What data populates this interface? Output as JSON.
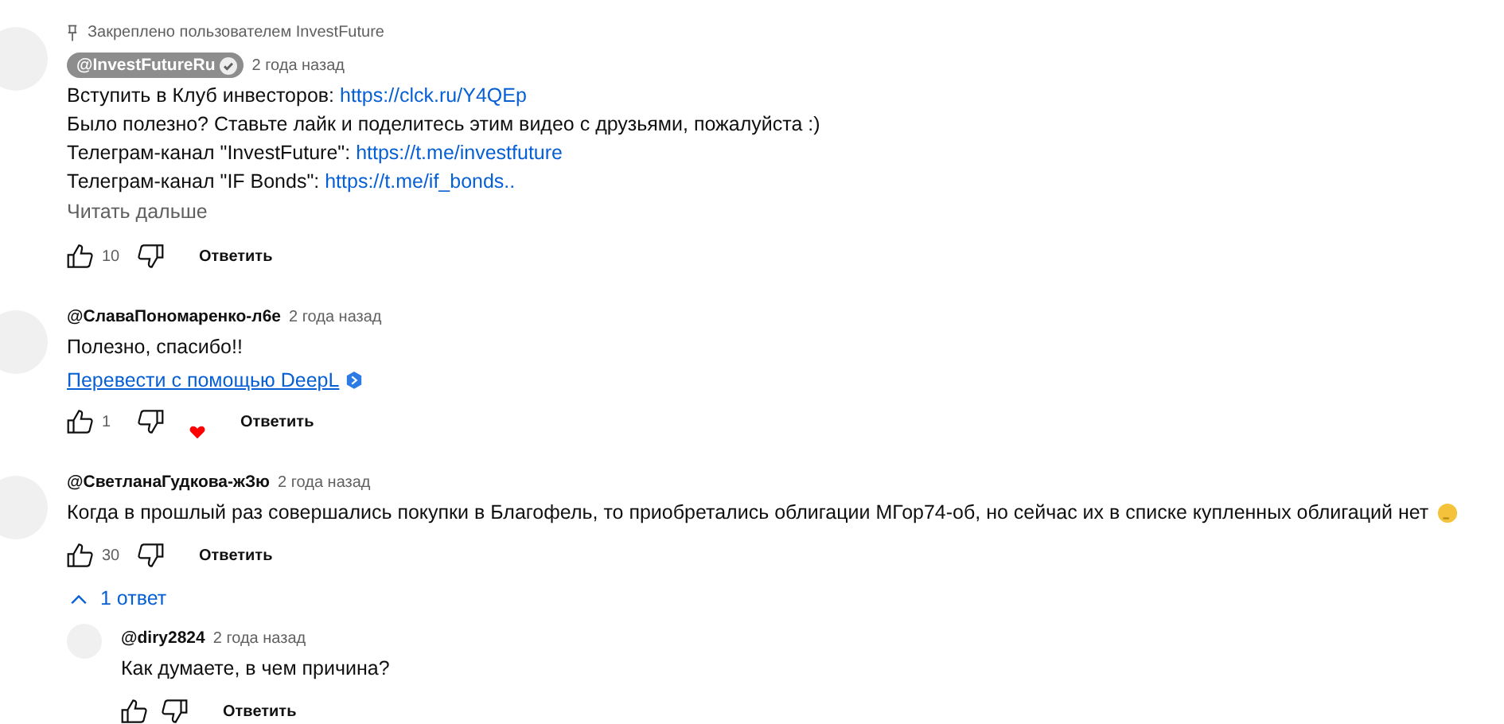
{
  "comments": [
    {
      "pinned": "Закреплено пользователем InvestFuture",
      "author": "@InvestFutureRu",
      "owner": true,
      "verified": true,
      "time": "2 года назад",
      "lines": [
        [
          {
            "t": "Вступить в Клуб инвесторов: "
          },
          {
            "t": "https://clck.ru/Y4QEp",
            "link": true
          }
        ],
        [
          {
            "t": "Было полезно? Ставьте лайк и поделитесь этим видео с друзьями, пожалуйста :)"
          }
        ],
        [
          {
            "t": "Телеграм-канал \"InvestFuture\": "
          },
          {
            "t": "https://t.me/investfuture",
            "link": true
          }
        ],
        [
          {
            "t": "Телеграм-канал \"IF Bonds\": "
          },
          {
            "t": "https://t.me/if_bonds..",
            "link": true
          }
        ]
      ],
      "more": "Читать дальше",
      "likes": "10",
      "hearted": false,
      "reply": "Ответить"
    },
    {
      "author": "@СлаваПономаренко-л6е",
      "owner": false,
      "verified": false,
      "time": "2 года назад",
      "lines": [
        [
          {
            "t": "Полезно, спасибо!!"
          }
        ]
      ],
      "translate": "Перевести с помощью DeepL",
      "likes": "1",
      "hearted": true,
      "reply": "Ответить"
    },
    {
      "author": "@СветланаГудкова-жЗю",
      "owner": false,
      "verified": false,
      "time": "2 года назад",
      "lines": [
        [
          {
            "t": "Когда в прошлый раз совершались покупки в Благофель, то приобретались облигации МГор74-об, но сейчас их в списке купленных облигаций нет"
          }
        ]
      ],
      "emoji": true,
      "likes": "30",
      "hearted": false,
      "reply": "Ответить",
      "replies_toggle": {
        "label": "1 ответ",
        "expanded": true
      },
      "replies": [
        {
          "author": "@diry2824",
          "time": "2 года назад",
          "lines": [
            [
              {
                "t": "Как думаете, в чем причина?"
              }
            ]
          ],
          "reply": "Ответить"
        }
      ]
    }
  ]
}
